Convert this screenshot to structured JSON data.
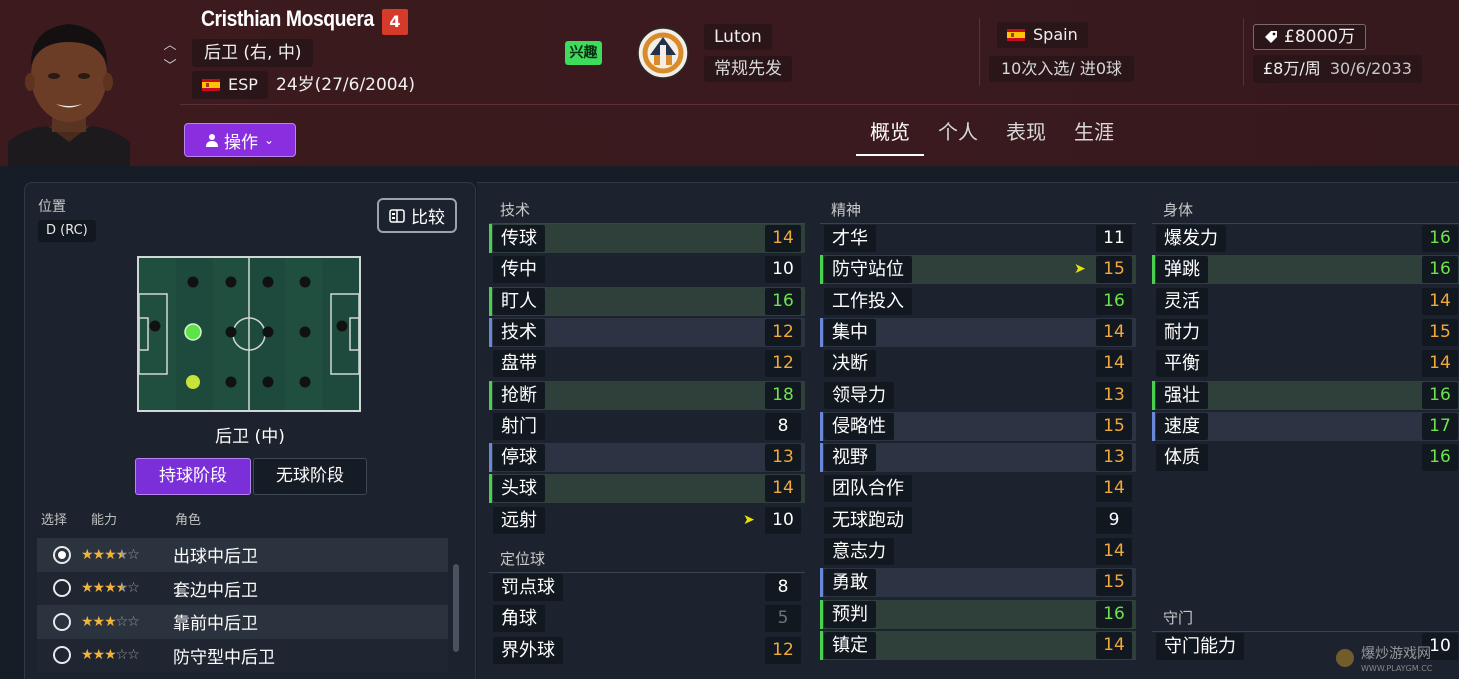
{
  "player": {
    "name": "Cristhian Mosquera",
    "number": "4",
    "position": "后卫 (右, 中)",
    "nation_code": "ESP",
    "age": "24岁(27/6/2004)",
    "interest": "兴趣"
  },
  "club": {
    "name": "Luton",
    "role": "常规先发"
  },
  "international": {
    "nation": "Spain",
    "caps": "10次入选/ 进0球"
  },
  "contract": {
    "value": "£8000万",
    "wage": "£8万/周",
    "expiry": "30/6/2033"
  },
  "action_button": "操作",
  "tabs": [
    "概览",
    "个人",
    "表现",
    "生涯"
  ],
  "position_panel": {
    "label": "位置",
    "code": "D (RC)",
    "compare": "比较",
    "selected_position": "后卫 (中)",
    "phase_in": "持球阶段",
    "phase_out": "无球阶段",
    "headers": {
      "select": "选择",
      "ability": "能力",
      "role": "角色"
    },
    "roles": [
      {
        "name": "出球中后卫",
        "stars": 3.5,
        "selected": true
      },
      {
        "name": "套边中后卫",
        "stars": 3.5,
        "selected": false
      },
      {
        "name": "靠前中后卫",
        "stars": 3,
        "selected": false
      },
      {
        "name": "防守型中后卫",
        "stars": 3,
        "selected": false
      }
    ]
  },
  "attributes": {
    "technical": {
      "title": "技术",
      "items": [
        {
          "name": "传球",
          "value": "14",
          "color": "orange",
          "hl": "green"
        },
        {
          "name": "传中",
          "value": "10",
          "color": "white",
          "hl": ""
        },
        {
          "name": "盯人",
          "value": "16",
          "color": "green",
          "hl": "green"
        },
        {
          "name": "技术",
          "value": "12",
          "color": "orange",
          "hl": "blue"
        },
        {
          "name": "盘带",
          "value": "12",
          "color": "orange",
          "hl": ""
        },
        {
          "name": "抢断",
          "value": "18",
          "color": "green",
          "hl": "green"
        },
        {
          "name": "射门",
          "value": "8",
          "color": "white",
          "hl": ""
        },
        {
          "name": "停球",
          "value": "13",
          "color": "orange",
          "hl": "blue"
        },
        {
          "name": "头球",
          "value": "14",
          "color": "orange",
          "hl": "green"
        },
        {
          "name": "远射",
          "value": "10",
          "color": "white",
          "hl": "",
          "arrow": true
        }
      ]
    },
    "set_pieces": {
      "title": "定位球",
      "items": [
        {
          "name": "罚点球",
          "value": "8",
          "color": "white",
          "hl": ""
        },
        {
          "name": "角球",
          "value": "5",
          "color": "gray",
          "hl": ""
        },
        {
          "name": "界外球",
          "value": "12",
          "color": "orange",
          "hl": ""
        }
      ]
    },
    "mental": {
      "title": "精神",
      "items": [
        {
          "name": "才华",
          "value": "11",
          "color": "white",
          "hl": ""
        },
        {
          "name": "防守站位",
          "value": "15",
          "color": "orange",
          "hl": "green",
          "arrow": true
        },
        {
          "name": "工作投入",
          "value": "16",
          "color": "green",
          "hl": ""
        },
        {
          "name": "集中",
          "value": "14",
          "color": "orange",
          "hl": "blue"
        },
        {
          "name": "决断",
          "value": "14",
          "color": "orange",
          "hl": ""
        },
        {
          "name": "领导力",
          "value": "13",
          "color": "orange",
          "hl": ""
        },
        {
          "name": "侵略性",
          "value": "15",
          "color": "orange",
          "hl": "blue"
        },
        {
          "name": "视野",
          "value": "13",
          "color": "orange",
          "hl": "blue"
        },
        {
          "name": "团队合作",
          "value": "14",
          "color": "orange",
          "hl": ""
        },
        {
          "name": "无球跑动",
          "value": "9",
          "color": "white",
          "hl": ""
        },
        {
          "name": "意志力",
          "value": "14",
          "color": "orange",
          "hl": ""
        },
        {
          "name": "勇敢",
          "value": "15",
          "color": "orange",
          "hl": "blue"
        },
        {
          "name": "预判",
          "value": "16",
          "color": "green",
          "hl": "green"
        },
        {
          "name": "镇定",
          "value": "14",
          "color": "orange",
          "hl": "green"
        }
      ]
    },
    "physical": {
      "title": "身体",
      "items": [
        {
          "name": "爆发力",
          "value": "16",
          "color": "green",
          "hl": ""
        },
        {
          "name": "弹跳",
          "value": "16",
          "color": "green",
          "hl": "green"
        },
        {
          "name": "灵活",
          "value": "14",
          "color": "orange",
          "hl": ""
        },
        {
          "name": "耐力",
          "value": "15",
          "color": "orange",
          "hl": ""
        },
        {
          "name": "平衡",
          "value": "14",
          "color": "orange",
          "hl": ""
        },
        {
          "name": "强壮",
          "value": "16",
          "color": "green",
          "hl": "green"
        },
        {
          "name": "速度",
          "value": "17",
          "color": "green",
          "hl": "blue"
        },
        {
          "name": "体质",
          "value": "16",
          "color": "green",
          "hl": ""
        }
      ]
    },
    "goalkeeping": {
      "title": "守门",
      "items": [
        {
          "name": "守门能力",
          "value": "10",
          "color": "white",
          "hl": ""
        }
      ]
    }
  },
  "watermark": "爆炒游戏网 WWW.PLAYGM.CC"
}
